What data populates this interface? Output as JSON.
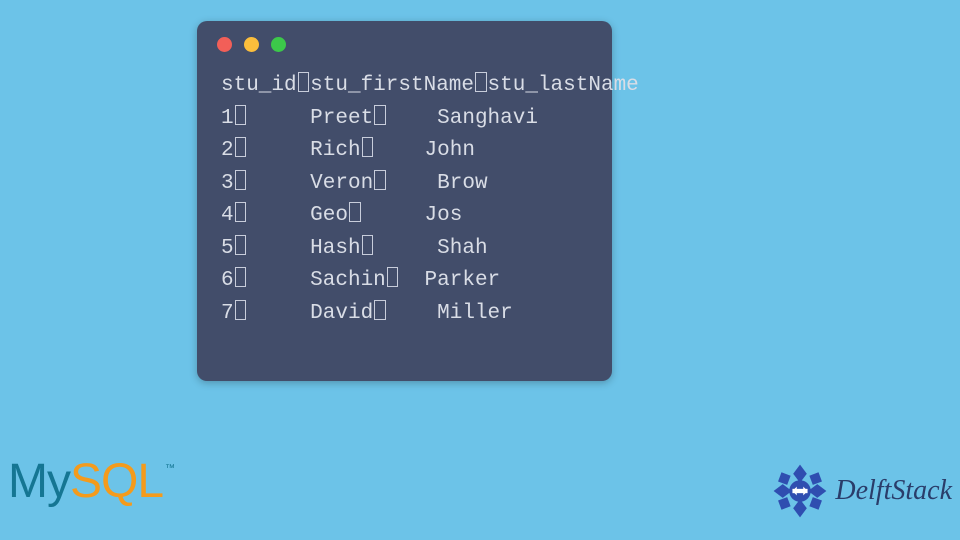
{
  "terminal": {
    "header": {
      "col1": "stu_id",
      "col2": "stu_firstName",
      "col3": "stu_lastName"
    },
    "rows": [
      {
        "id": "1",
        "first": "Preet",
        "last": "Sanghavi"
      },
      {
        "id": "2",
        "first": "Rich",
        "last": "John"
      },
      {
        "id": "3",
        "first": "Veron",
        "last": "Brow"
      },
      {
        "id": "4",
        "first": "Geo",
        "last": "Jos"
      },
      {
        "id": "5",
        "first": "Hash",
        "last": "Shah"
      },
      {
        "id": "6",
        "first": "Sachin",
        "last": "Parker"
      },
      {
        "id": "7",
        "first": "David",
        "last": "Miller"
      }
    ]
  },
  "logos": {
    "mysql_my": "My",
    "mysql_sql": "SQL",
    "mysql_tm": "™",
    "delft": "DelftStack"
  },
  "chart_data": {
    "type": "table",
    "title": "",
    "columns": [
      "stu_id",
      "stu_firstName",
      "stu_lastName"
    ],
    "rows": [
      [
        1,
        "Preet",
        "Sanghavi"
      ],
      [
        2,
        "Rich",
        "John"
      ],
      [
        3,
        "Veron",
        "Brow"
      ],
      [
        4,
        "Geo",
        "Jos"
      ],
      [
        5,
        "Hash",
        "Shah"
      ],
      [
        6,
        "Sachin",
        "Parker"
      ],
      [
        7,
        "David",
        "Miller"
      ]
    ]
  }
}
